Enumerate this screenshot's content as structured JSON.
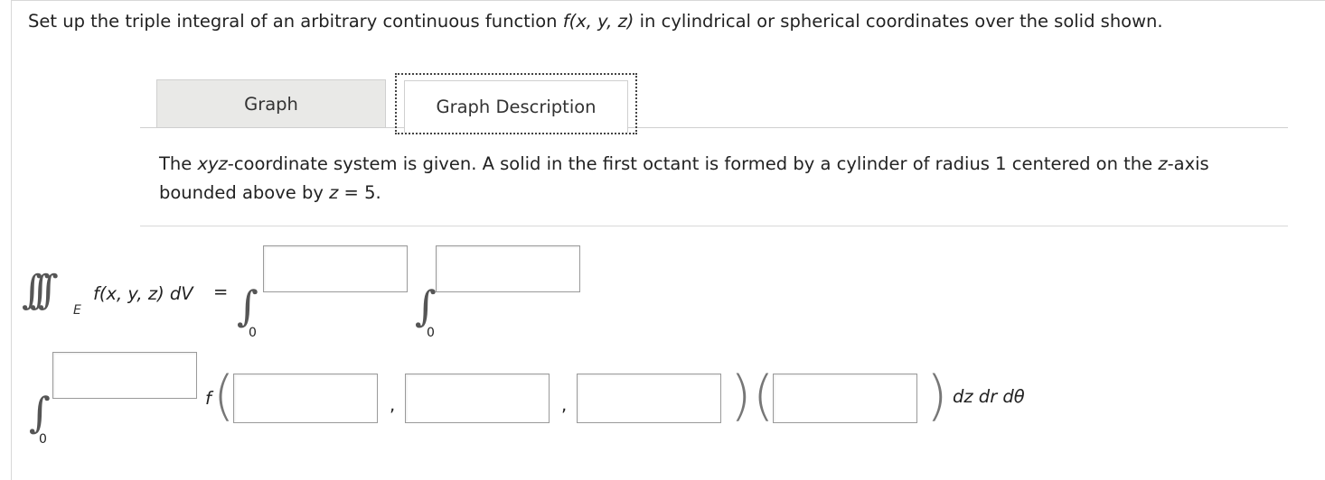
{
  "prompt": {
    "part1": "Set up the triple integral of an arbitrary continuous function ",
    "func": "f(x, y, z)",
    "part2": " in cylindrical or spherical coordinates over the solid shown."
  },
  "tabs": [
    {
      "label": "Graph"
    },
    {
      "label": "Graph Description"
    }
  ],
  "description": {
    "t1": "The ",
    "t2": "xyz",
    "t3": "-coordinate system is given. A solid in the first octant is formed by a cylinder of radius 1 centered on the ",
    "t4": "z",
    "t5": "-axis bounded above by ",
    "t6": "z",
    "t7": " = 5."
  },
  "equation": {
    "lhs_func": "f(x, y, z) dV",
    "equals": "=",
    "region": "E",
    "lower_limit": "0",
    "comma": ",",
    "f_label": "f",
    "differentials": "dz dr dθ"
  },
  "inputs": {
    "upper_limit_1": "",
    "upper_limit_2": "",
    "upper_limit_3": "",
    "f_arg_1": "",
    "f_arg_2": "",
    "f_arg_3": "",
    "jacobian": ""
  }
}
